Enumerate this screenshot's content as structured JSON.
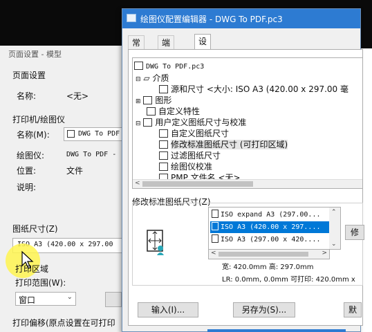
{
  "page_setup": {
    "title": "页面设置 - 模型",
    "section_page_setup": "页面设置",
    "name_label": "名称:",
    "name_value": "<无>",
    "printer_section": "打印机/绘图仪",
    "printer_name_label": "名称(M):",
    "printer_name_value": "DWG To PDF",
    "plotter_label": "绘图仪:",
    "plotter_value": "DWG To PDF - ",
    "location_label": "位置:",
    "location_value": "文件",
    "description_label": "说明:",
    "paper_size_label": "图纸尺寸(Z)",
    "paper_size_value": "ISO A3 (420.00 x 297.00",
    "plot_area_label": "打印区域",
    "plot_range_label": "打印范围(W):",
    "plot_range_value": "窗口",
    "plot_offset_label": "打印偏移(原点设置在可打印"
  },
  "editor": {
    "title": "绘图仪配置编辑器 - DWG To PDF.pc3",
    "tabs": [
      "常规",
      "端口",
      "设备和文档设置"
    ],
    "active_tab": 2,
    "tree": {
      "root": "DWG To PDF.pc3",
      "media": "介质",
      "source_size": "源和尺寸 <大小: ISO A3 (420.00 x 297.00 毫",
      "graphics": "图形",
      "custom_properties": "自定义特性",
      "user_defined": "用户定义图纸尺寸与校准",
      "custom_paper": "自定义图纸尺寸",
      "modify_std": "修改标准图纸尺寸 (可打印区域)",
      "filter_paper": "过滤图纸尺寸",
      "plotter_calib": "绘图仪校准",
      "pmp_file": "PMP 文件名 <无>"
    },
    "modify_section_label": "修改标准图纸尺寸(Z)",
    "paper_list": [
      "ISO expand A3 (297.00...",
      "ISO A3 (420.00 x 297....",
      "ISO A3 (297.00 x 420...."
    ],
    "selected_paper_index": 1,
    "modify_button": "修",
    "size_info": "宽: 420.0mm 高: 297.0mm",
    "margin_info": "LR: 0.0mm, 0.0mm  可打印: 420.0mm x",
    "import_button": "输入(I)...",
    "save_as_button": "另存为(S)...",
    "default_button": "默"
  }
}
